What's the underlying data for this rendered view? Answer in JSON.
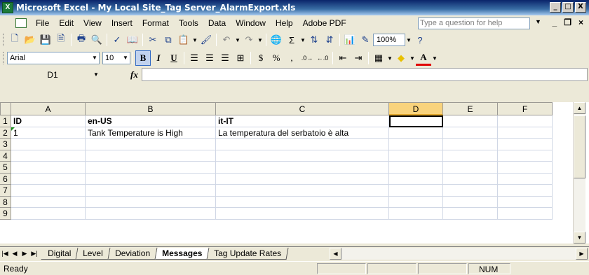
{
  "window": {
    "title": "Microsoft Excel - My Local Site_Tag Server_AlarmExport.xls",
    "app_icon": "excel-icon",
    "controls": [
      "_",
      "□",
      "X"
    ]
  },
  "menu": {
    "items": [
      "File",
      "Edit",
      "View",
      "Insert",
      "Format",
      "Tools",
      "Data",
      "Window",
      "Help",
      "Adobe PDF"
    ],
    "help_placeholder": "Type a question for help",
    "doc_controls": [
      "_",
      "❐",
      "×"
    ]
  },
  "standard_toolbar": {
    "zoom": "100%"
  },
  "formatting_toolbar": {
    "font": "Arial",
    "size": "10",
    "bold": "B",
    "italic": "I",
    "underline": "U",
    "currency": "$",
    "percent": "%",
    "comma": ",",
    "font_color_letter": "A"
  },
  "formula_bar": {
    "name_box": "D1",
    "fx": "fx",
    "content": ""
  },
  "columns": [
    "A",
    "B",
    "C",
    "D",
    "E",
    "F"
  ],
  "active_column": "D",
  "rows": [
    {
      "n": "1",
      "cells": [
        "ID",
        "en-US",
        "it-IT",
        "",
        "",
        ""
      ]
    },
    {
      "n": "2",
      "cells": [
        "1",
        "Tank Temperature is High",
        "La temperatura del serbatoio è alta",
        "",
        "",
        ""
      ]
    },
    {
      "n": "3",
      "cells": [
        "",
        "",
        "",
        "",
        "",
        ""
      ]
    },
    {
      "n": "4",
      "cells": [
        "",
        "",
        "",
        "",
        "",
        ""
      ]
    },
    {
      "n": "5",
      "cells": [
        "",
        "",
        "",
        "",
        "",
        ""
      ]
    },
    {
      "n": "6",
      "cells": [
        "",
        "",
        "",
        "",
        "",
        ""
      ]
    },
    {
      "n": "7",
      "cells": [
        "",
        "",
        "",
        "",
        "",
        ""
      ]
    },
    {
      "n": "8",
      "cells": [
        "",
        "",
        "",
        "",
        "",
        ""
      ]
    },
    {
      "n": "9",
      "cells": [
        "",
        "",
        "",
        "",
        "",
        ""
      ]
    }
  ],
  "sheets": [
    {
      "label": "Digital",
      "active": false
    },
    {
      "label": "Level",
      "active": false
    },
    {
      "label": "Deviation",
      "active": false
    },
    {
      "label": "Messages",
      "active": true
    },
    {
      "label": "Tag Update Rates",
      "active": false
    }
  ],
  "status": {
    "text": "Ready",
    "num": "NUM"
  }
}
